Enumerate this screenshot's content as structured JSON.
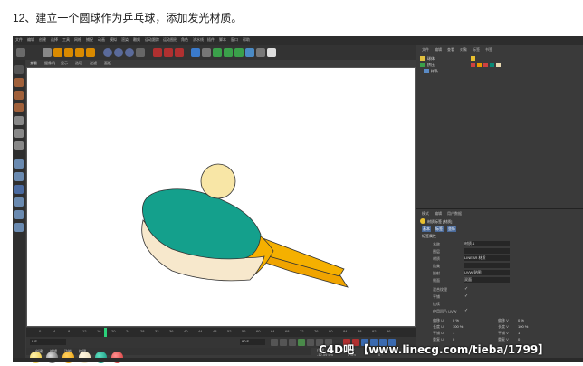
{
  "caption": "12、建立一个圆球作为乒乓球，添加发光材质。",
  "menu": [
    "文件",
    "编辑",
    "创建",
    "选择",
    "工具",
    "网格",
    "捕捉",
    "动画",
    "模拟",
    "渲染",
    "雕刻",
    "运动跟踪",
    "运动图形",
    "角色",
    "流水线",
    "插件",
    "脚本",
    "窗口",
    "帮助"
  ],
  "viewport_tabs": [
    "查看",
    "摄像机",
    "显示",
    "选项",
    "过滤",
    "面板"
  ],
  "timeline_ticks": [
    "0",
    "4",
    "8",
    "12",
    "16",
    "20",
    "24",
    "28",
    "32",
    "36",
    "40",
    "44",
    "48",
    "52",
    "56",
    "60",
    "64",
    "68",
    "72",
    "76",
    "80",
    "84",
    "88",
    "92",
    "96"
  ],
  "frame_field": "0 F",
  "end_frame": "90 F",
  "material_tabs": [
    "创建",
    "编辑",
    "功能",
    "纹理"
  ],
  "object_panel": {
    "tabs": [
      "文件",
      "编辑",
      "查看",
      "对象",
      "标签",
      "书签"
    ],
    "objects": [
      "球体",
      "挤压",
      "样条"
    ]
  },
  "attr_panel": {
    "tabs": [
      "模式",
      "编辑",
      "用户数据"
    ],
    "header": "材质标签 [材质]",
    "sub_tabs": [
      "基本",
      "标签",
      "坐标"
    ],
    "section": "标签属性",
    "rows": [
      {
        "key": "名称",
        "value": "材质.1"
      },
      {
        "key": "图层",
        "value": ""
      },
      {
        "key": "材质",
        "value": "LINEAR 材质"
      },
      {
        "key": "选集",
        "value": ""
      },
      {
        "key": "投射",
        "value": "UVW 贴图"
      },
      {
        "key": "侧面",
        "value": "双面"
      },
      {
        "key": "混合纹理",
        "value": "✓"
      },
      {
        "key": "平铺",
        "value": "✓"
      },
      {
        "key": "连续",
        "value": ""
      },
      {
        "key": "使用凹凸 UVW",
        "value": "✓"
      }
    ],
    "offsets": [
      {
        "key": "偏移 U",
        "value": "0 %"
      },
      {
        "key": "偏移 V",
        "value": "0 %"
      },
      {
        "key": "长度 U",
        "value": "100 %"
      },
      {
        "key": "长度 V",
        "value": "100 %"
      },
      {
        "key": "平铺 U",
        "value": "1"
      },
      {
        "key": "平铺 V",
        "value": "1"
      },
      {
        "key": "重复 U",
        "value": "0"
      },
      {
        "key": "重复 V",
        "value": "0"
      }
    ]
  },
  "coords": {
    "headers": [
      "位置",
      "尺寸",
      "旋转"
    ],
    "rows": [
      {
        "axis": "X",
        "pos": "-12.59 cm",
        "size": "0 cm",
        "rot": "0 °"
      },
      {
        "axis": "Y",
        "pos": "64.55 cm",
        "size": "0 cm",
        "rot": "0 °"
      },
      {
        "axis": "Z",
        "pos": "0 cm",
        "size": "0 cm",
        "rot": "0 °"
      }
    ]
  },
  "watermark": "C4D吧 【www.linecg.com/tieba/1799】",
  "colors": {
    "paddle_face": "#14a08c",
    "paddle_edge": "#f7e8cc",
    "handle": "#f5b000",
    "ball": "#f8e6a6"
  }
}
